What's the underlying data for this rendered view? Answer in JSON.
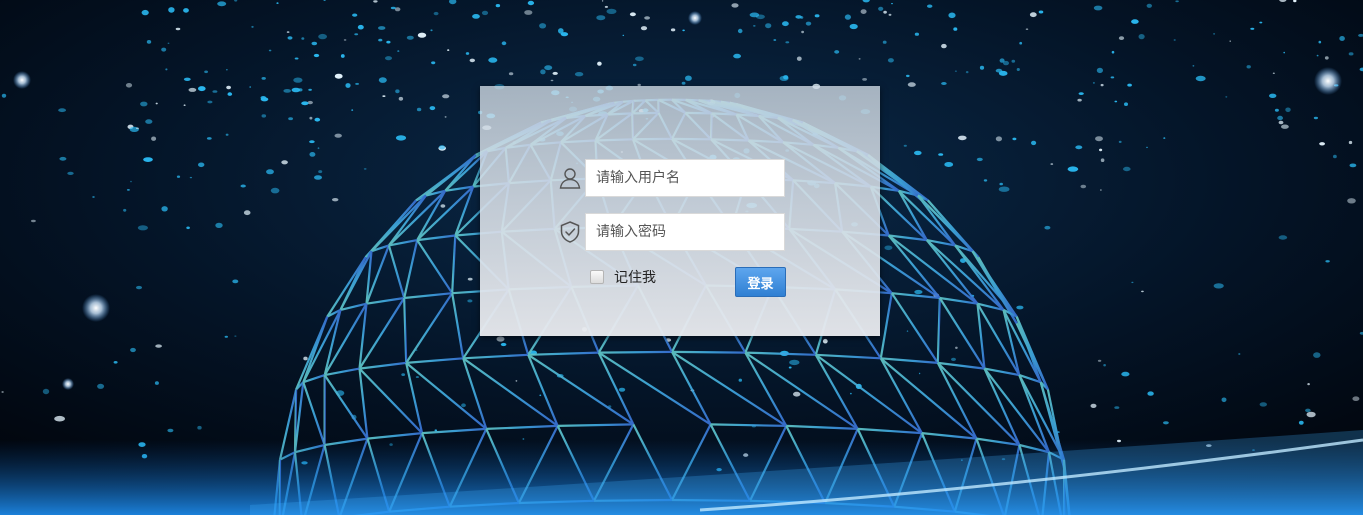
{
  "login": {
    "username_placeholder": "请输入用户名",
    "password_placeholder": "请输入密码",
    "remember_label": "记住我",
    "remember_checked": false,
    "login_label": "登录"
  },
  "icons": {
    "username": "user-icon",
    "password": "shield-check-icon"
  },
  "colors": {
    "background": "#02060f",
    "globe_lines": "#3aa8d8",
    "button": "#2f7fd3",
    "stars": "#2ab8f0"
  }
}
